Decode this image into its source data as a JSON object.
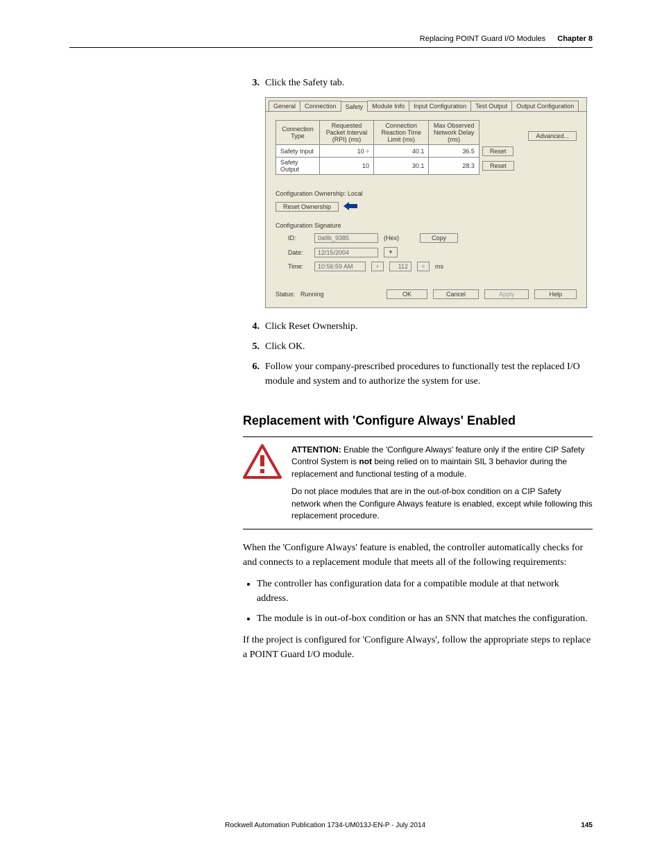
{
  "header": {
    "title": "Replacing POINT Guard I/O Modules",
    "chapter": "Chapter 8"
  },
  "steps": {
    "s3": {
      "num": "3.",
      "text": "Click the Safety tab."
    },
    "s4": {
      "num": "4.",
      "text": "Click Reset Ownership."
    },
    "s5": {
      "num": "5.",
      "text": "Click OK."
    },
    "s6": {
      "num": "6.",
      "text": "Follow your company-prescribed procedures to functionally test the replaced I/O module and system and to authorize the system for use."
    }
  },
  "dlg": {
    "tabs": {
      "general": "General",
      "connection": "Connection",
      "safety": "Safety",
      "module_info": "Module Info",
      "input_config": "Input Configuration",
      "test_output": "Test Output",
      "output_config": "Output Configuration"
    },
    "table": {
      "h_type": "Connection Type",
      "h_rpi": "Requested Packet Interval (RPI) (ms)",
      "h_crt": "Connection Reaction Time Limit (ms)",
      "h_max": "Max Observed Network Delay (ms)",
      "r1_type": "Safety Input",
      "r1_rpi": "10",
      "r1_crt": "40.1",
      "r1_max": "36.5",
      "r1_reset": "Reset",
      "r2_type": "Safety Output",
      "r2_rpi": "10",
      "r2_crt": "30.1",
      "r2_max": "28.3",
      "r2_reset": "Reset"
    },
    "advanced": "Advanced...",
    "ownership_label": "Configuration Ownership: Local",
    "reset_ownership": "Reset Ownership",
    "sig_label": "Configuration Signature",
    "id_label": "ID:",
    "id_value": "0a9b_9385",
    "id_hex": "(Hex)",
    "copy": "Copy",
    "date_label": "Date:",
    "date_value": "12/15/2004",
    "time_label": "Time:",
    "time_value": "10:56:59 AM",
    "time_ms": "112",
    "time_unit": "ms",
    "status_label": "Status:",
    "status_value": "Running",
    "ok": "OK",
    "cancel": "Cancel",
    "apply": "Apply",
    "help": "Help"
  },
  "section": {
    "heading": "Replacement with 'Configure Always' Enabled"
  },
  "attention": {
    "p1a": "ATTENTION: ",
    "p1b": "Enable the 'Configure Always' feature only if the entire CIP Safety Control System is ",
    "p1bold": "not",
    "p1c": " being relied on to maintain SIL 3 behavior during the replacement and functional testing of a module.",
    "p2": "Do not place modules that are in the out-of-box condition on a CIP Safety network when the Configure Always feature is enabled, except while following this replacement procedure."
  },
  "paras": {
    "intro": "When the 'Configure Always' feature is enabled, the controller automatically checks for and connects to a replacement module that meets all of the following requirements:",
    "b1": "The controller has configuration data for a compatible module at that network address.",
    "b2": "The module is in out-of-box condition or has an SNN that matches the configuration.",
    "outro": "If the project is configured for 'Configure Always', follow the appropriate steps to replace a POINT Guard I/O module."
  },
  "footer": {
    "pub": "Rockwell Automation Publication 1734-UM013J-EN-P - July 2014",
    "page": "145"
  }
}
